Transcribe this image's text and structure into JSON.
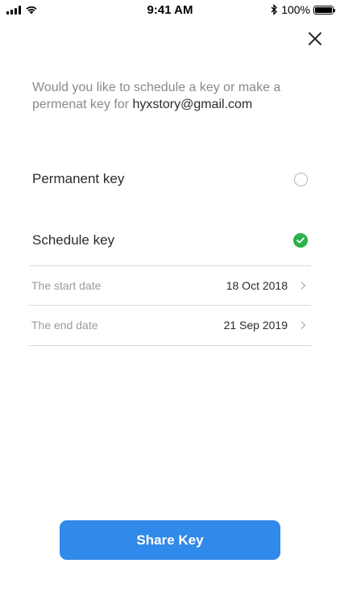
{
  "status_bar": {
    "time": "9:41 AM",
    "battery": "100%",
    "icons": [
      "signal-icon",
      "wifi-icon",
      "bluetooth-icon",
      "battery-icon"
    ]
  },
  "prompt": {
    "text": "Would you like to schedule a key or make a permenat key for",
    "email": "hyxstory@gmail.com"
  },
  "options": {
    "permanent": {
      "label": "Permanent key",
      "selected": false
    },
    "schedule": {
      "label": "Schedule key",
      "selected": true
    }
  },
  "dates": {
    "start": {
      "label": "The start date",
      "value": "18 Oct 2018"
    },
    "end": {
      "label": "The end date",
      "value": "21 Sep 2019"
    }
  },
  "share_button": {
    "label": "Share Key"
  },
  "colors": {
    "accent": "#3189ea",
    "check": "#2bb24c",
    "divider": "#d9d9d9"
  }
}
